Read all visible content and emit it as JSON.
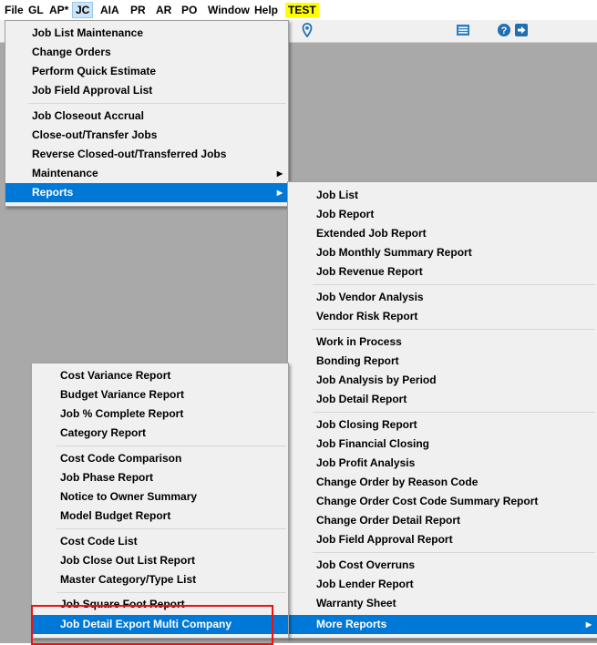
{
  "menubar": {
    "items": [
      "File",
      "GL",
      "AP*",
      "JC",
      "AIA",
      "PR",
      "AR",
      "PO",
      "Window",
      "Help",
      "TEST"
    ]
  },
  "jc_menu": {
    "items": [
      "Job List Maintenance",
      "Change Orders",
      "Perform Quick Estimate",
      "Job Field Approval List",
      "Job Closeout Accrual",
      "Close-out/Transfer Jobs",
      "Reverse Closed-out/Transferred Jobs",
      "Maintenance",
      "Reports"
    ]
  },
  "reports_menu": {
    "items": [
      "Job List",
      "Job Report",
      "Extended Job Report",
      "Job Monthly Summary Report",
      "Job Revenue Report",
      "Job Vendor Analysis",
      "Vendor Risk Report",
      "Work in Process",
      "Bonding Report",
      "Job Analysis by Period",
      "Job Detail Report",
      "Job Closing Report",
      "Job Financial Closing",
      "Job Profit Analysis",
      "Change Order by Reason Code",
      "Change Order Cost Code Summary Report",
      "Change Order Detail Report",
      "Job Field Approval Report",
      "Job Cost Overruns",
      "Job Lender Report",
      "Warranty Sheet",
      "More Reports"
    ]
  },
  "more_reports_menu": {
    "items": [
      "Cost Variance Report",
      "Budget Variance Report",
      "Job % Complete Report",
      "Category Report",
      "Cost Code Comparison",
      "Job Phase Report",
      "Notice to Owner Summary",
      "Model Budget Report",
      "Cost Code List",
      "Job Close Out List Report",
      "Master Category/Type List",
      "Job Square Foot Report",
      "Job Detail Export Multi Company"
    ]
  },
  "colors": {
    "highlight": "#0078d7",
    "workspace": "#a9a9a9",
    "test_badge": "#ffff00",
    "annotation_box": "#ee1111"
  },
  "icons": {
    "toolbar": [
      "location-pin-icon",
      "list-icon",
      "help-icon",
      "exit-icon"
    ]
  }
}
